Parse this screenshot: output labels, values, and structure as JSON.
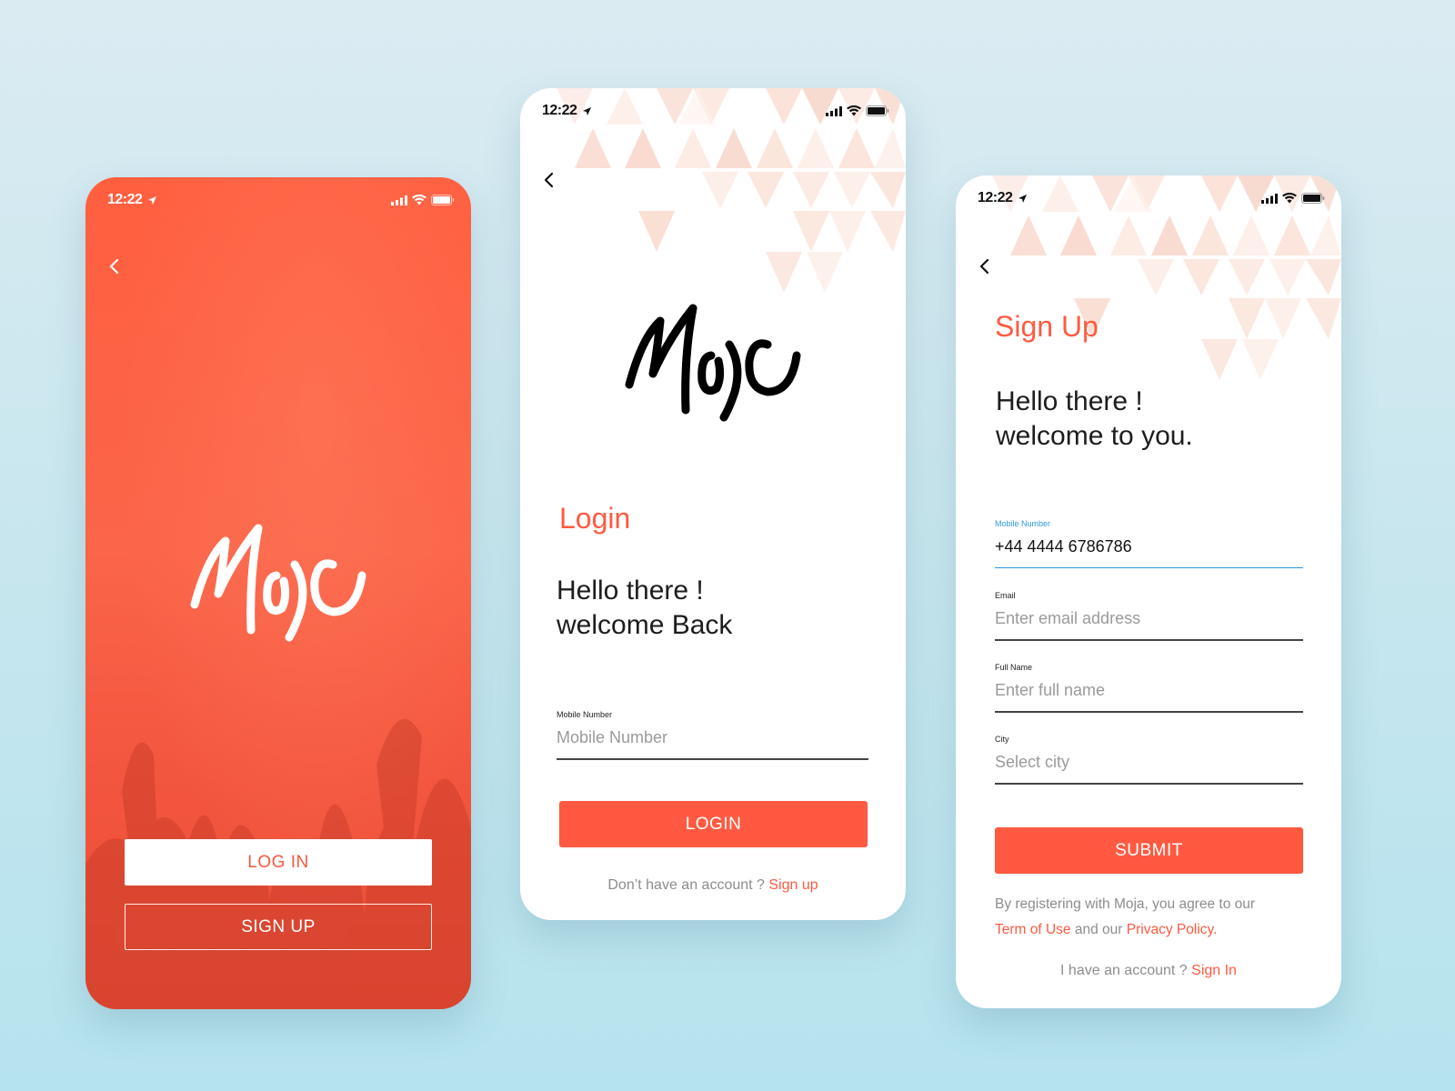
{
  "colors": {
    "accent": "#ff5a41",
    "active_field": "#2a9ae0",
    "background_top": "#dbebf2",
    "background_bottom": "#b5e3ee"
  },
  "status_bar": {
    "time": "12:22",
    "icons": [
      "location-arrow-icon",
      "signal-icon",
      "wifi-icon",
      "battery-icon"
    ]
  },
  "welcome_screen": {
    "logo_text": "Moja",
    "login_button": "LOG IN",
    "signup_button": "SIGN UP"
  },
  "login_screen": {
    "logo_text": "Moja",
    "title": "Login",
    "greeting_line1": "Hello there !",
    "greeting_line2": "welcome Back",
    "mobile_field": {
      "label": "Mobile Number",
      "placeholder": "Mobile Number",
      "value": ""
    },
    "login_button": "LOGIN",
    "footer_text": "Don’t have an account ?",
    "footer_link": "Sign up"
  },
  "signup_screen": {
    "title": "Sign Up",
    "greeting_line1": "Hello there !",
    "greeting_line2": "welcome to you.",
    "fields": [
      {
        "label": "Mobile Number",
        "placeholder": "",
        "value": "+44 4444 6786786"
      },
      {
        "label": "Email",
        "placeholder": "Enter email address",
        "value": ""
      },
      {
        "label": "Full Name",
        "placeholder": "Enter full name",
        "value": ""
      },
      {
        "label": "City",
        "placeholder": "Select city",
        "value": ""
      }
    ],
    "submit_button": "SUBMIT",
    "legal_text_1": "By registering with Moja, you agree to our",
    "legal_link_terms": "Term of Use",
    "legal_text_2": "and our",
    "legal_link_privacy": "Privacy Policy.",
    "footer_text": "I have an account ?",
    "footer_link": "Sign In"
  }
}
